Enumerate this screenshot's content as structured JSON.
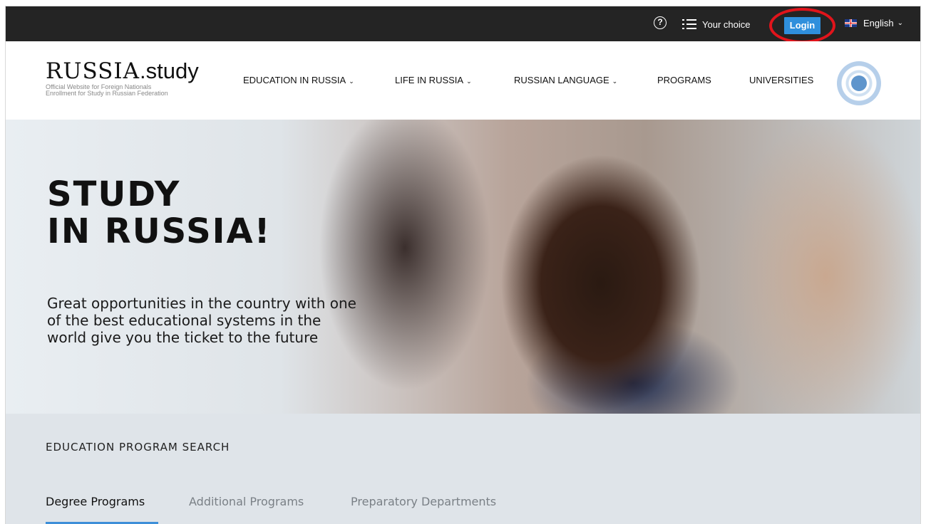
{
  "topbar": {
    "help_icon": "question-circle-icon",
    "choice_label": "Your choice",
    "login_label": "Login",
    "language_label": "English",
    "highlight_color": "#e1141b",
    "login_color": "#2f8fdc"
  },
  "logo": {
    "main": "RUSSIA",
    "suffix": ".study",
    "subtitle_line1": "Official Website for Foreign Nationals",
    "subtitle_line2": "Enrollment for Study in Russian Federation"
  },
  "nav": {
    "items": [
      {
        "label": "EDUCATION IN RUSSIA",
        "dropdown": true
      },
      {
        "label": "LIFE IN RUSSIA",
        "dropdown": true
      },
      {
        "label": "RUSSIAN LANGUAGE",
        "dropdown": true
      },
      {
        "label": "PROGRAMS",
        "dropdown": false
      },
      {
        "label": "UNIVERSITIES",
        "dropdown": false
      }
    ]
  },
  "hero": {
    "title_line1": "STUDY",
    "title_line2": "IN RUSSIA!",
    "text_line1": "Great opportunities in the country with one",
    "text_line2": "of the best educational systems in the",
    "text_line3": "world give you the ticket to the future"
  },
  "search": {
    "title": "EDUCATION PROGRAM SEARCH",
    "tabs": [
      {
        "label": "Degree Programs",
        "active": true
      },
      {
        "label": "Additional Programs",
        "active": false
      },
      {
        "label": "Preparatory Departments",
        "active": false
      }
    ],
    "accent_color": "#3d8fd8"
  }
}
